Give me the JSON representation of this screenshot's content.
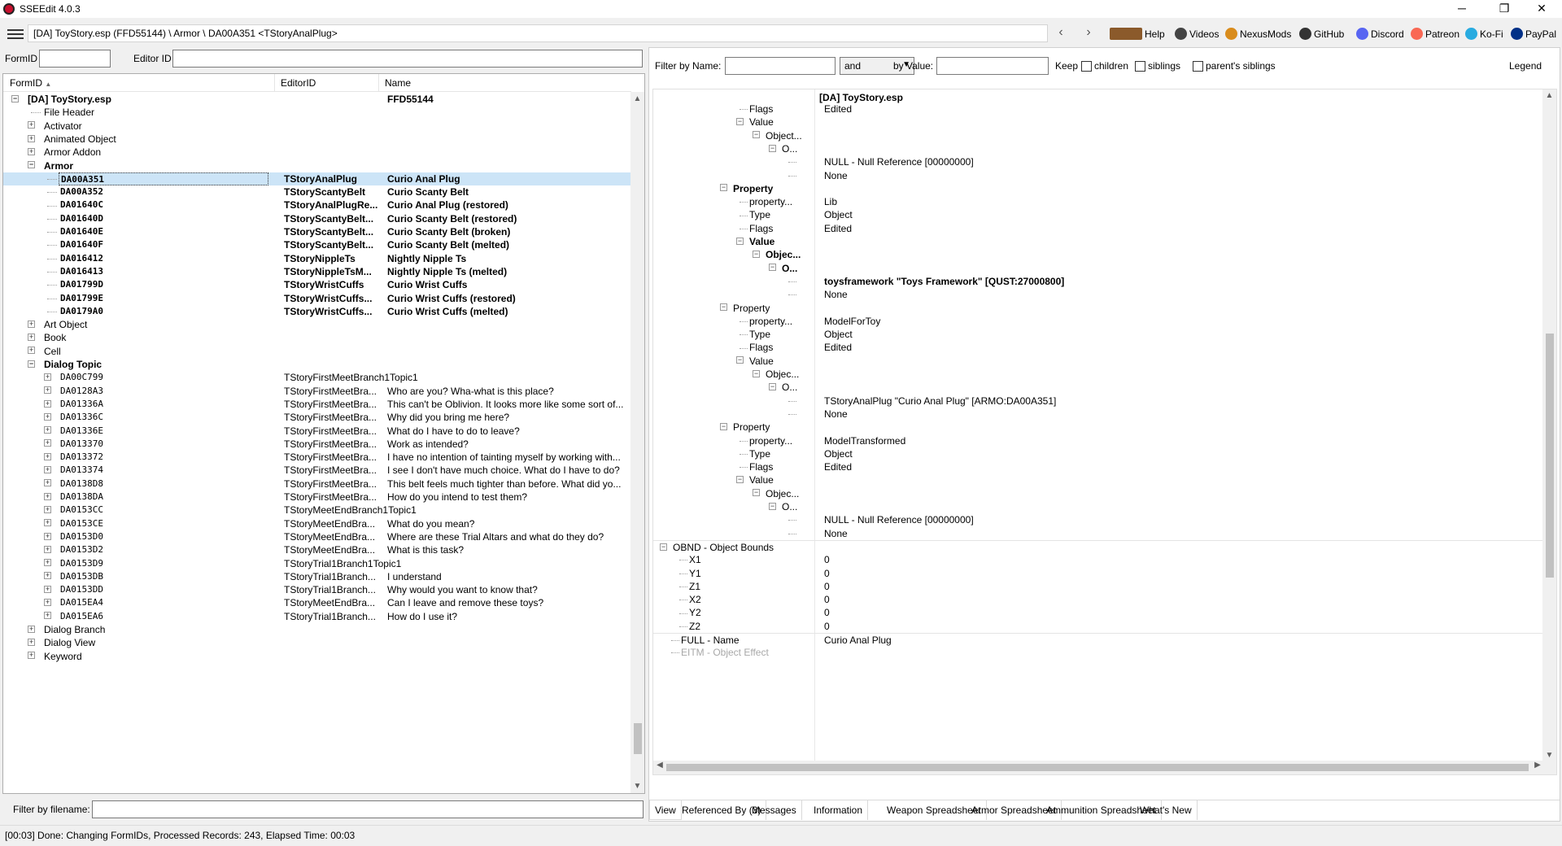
{
  "window": {
    "title": "SSEEdit 4.0.3",
    "minimize": "─",
    "maximize": "❐",
    "close": "✕"
  },
  "toolbar": {
    "path": "[DA] ToyStory.esp (FFD55144) \\ Armor \\ DA00A351 <TStoryAnalPlug>",
    "back": "‹",
    "forward": "›",
    "links": [
      {
        "label": "Help",
        "color": "#8b5a2b"
      },
      {
        "label": "Videos",
        "color": "#444444"
      },
      {
        "label": "NexusMods",
        "color": "#d98c1c"
      },
      {
        "label": "GitHub",
        "color": "#333333"
      },
      {
        "label": "Discord",
        "color": "#5865f2"
      },
      {
        "label": "Patreon",
        "color": "#f96854"
      },
      {
        "label": "Ko-Fi",
        "color": "#29abe0"
      },
      {
        "label": "PayPal",
        "color": "#003087"
      }
    ]
  },
  "left": {
    "formid_label": "FormID",
    "formid_value": "",
    "editorid_label": "Editor ID",
    "editorid_value": "",
    "columns": [
      "FormID",
      "EditorID",
      "Name"
    ],
    "sort_arrow": "▲",
    "filename_label": "Filter by filename:",
    "filename_value": "",
    "rows": [
      {
        "level": 0,
        "exp": "⊟",
        "formid": "[DA] ToyStory.esp",
        "editor": "",
        "name": "FFD55144",
        "bold": true,
        "mono": false
      },
      {
        "level": 1,
        "exp": "",
        "formid": "File Header",
        "editor": "",
        "name": "",
        "bold": false,
        "mono": false
      },
      {
        "level": 1,
        "exp": "⊞",
        "formid": "Activator",
        "editor": "",
        "name": "",
        "bold": false,
        "mono": false
      },
      {
        "level": 1,
        "exp": "⊞",
        "formid": "Animated Object",
        "editor": "",
        "name": "",
        "bold": false,
        "mono": false
      },
      {
        "level": 1,
        "exp": "⊞",
        "formid": "Armor Addon",
        "editor": "",
        "name": "",
        "bold": false,
        "mono": false
      },
      {
        "level": 1,
        "exp": "⊟",
        "formid": "Armor",
        "editor": "",
        "name": "",
        "bold": true,
        "mono": false
      },
      {
        "level": 2,
        "exp": "",
        "formid": "DA00A351",
        "editor": "TStoryAnalPlug",
        "name": "Curio Anal Plug",
        "bold": true,
        "mono": true,
        "sel": true
      },
      {
        "level": 2,
        "exp": "",
        "formid": "DA00A352",
        "editor": "TStoryScantyBelt",
        "name": "Curio Scanty Belt",
        "bold": true,
        "mono": true
      },
      {
        "level": 2,
        "exp": "",
        "formid": "DA01640C",
        "editor": "TStoryAnalPlugRe...",
        "name": "Curio Anal Plug (restored)",
        "bold": true,
        "mono": true
      },
      {
        "level": 2,
        "exp": "",
        "formid": "DA01640D",
        "editor": "TStoryScantyBelt...",
        "name": "Curio Scanty Belt (restored)",
        "bold": true,
        "mono": true
      },
      {
        "level": 2,
        "exp": "",
        "formid": "DA01640E",
        "editor": "TStoryScantyBelt...",
        "name": "Curio Scanty Belt (broken)",
        "bold": true,
        "mono": true
      },
      {
        "level": 2,
        "exp": "",
        "formid": "DA01640F",
        "editor": "TStoryScantyBelt...",
        "name": "Curio Scanty Belt (melted)",
        "bold": true,
        "mono": true
      },
      {
        "level": 2,
        "exp": "",
        "formid": "DA016412",
        "editor": "TStoryNippleTs",
        "name": "Nightly Nipple Ts",
        "bold": true,
        "mono": true
      },
      {
        "level": 2,
        "exp": "",
        "formid": "DA016413",
        "editor": "TStoryNippleTsM...",
        "name": "Nightly Nipple Ts (melted)",
        "bold": true,
        "mono": true
      },
      {
        "level": 2,
        "exp": "",
        "formid": "DA01799D",
        "editor": "TStoryWristCuffs",
        "name": "Curio Wrist Cuffs",
        "bold": true,
        "mono": true
      },
      {
        "level": 2,
        "exp": "",
        "formid": "DA01799E",
        "editor": "TStoryWristCuffs...",
        "name": "Curio Wrist Cuffs (restored)",
        "bold": true,
        "mono": true
      },
      {
        "level": 2,
        "exp": "",
        "formid": "DA0179A0",
        "editor": "TStoryWristCuffs...",
        "name": "Curio Wrist Cuffs (melted)",
        "bold": true,
        "mono": true
      },
      {
        "level": 1,
        "exp": "⊞",
        "formid": "Art Object",
        "editor": "",
        "name": "",
        "bold": false,
        "mono": false
      },
      {
        "level": 1,
        "exp": "⊞",
        "formid": "Book",
        "editor": "",
        "name": "",
        "bold": false,
        "mono": false
      },
      {
        "level": 1,
        "exp": "⊞",
        "formid": "Cell",
        "editor": "",
        "name": "",
        "bold": false,
        "mono": false
      },
      {
        "level": 1,
        "exp": "⊟",
        "formid": "Dialog Topic",
        "editor": "",
        "name": "",
        "bold": true,
        "mono": false
      },
      {
        "level": 2,
        "exp": "⊞",
        "formid": "DA00C799",
        "editor": "TStoryFirstMeetBranch1Topic1",
        "name": "",
        "bold": false,
        "mono": true,
        "wide": true
      },
      {
        "level": 2,
        "exp": "⊞",
        "formid": "DA0128A3",
        "editor": "TStoryFirstMeetBra...",
        "name": "Who are you? Wha-what is this place?",
        "bold": false,
        "mono": true
      },
      {
        "level": 2,
        "exp": "⊞",
        "formid": "DA01336A",
        "editor": "TStoryFirstMeetBra...",
        "name": "This can't be Oblivion.  It looks more like some sort of...",
        "bold": false,
        "mono": true
      },
      {
        "level": 2,
        "exp": "⊞",
        "formid": "DA01336C",
        "editor": "TStoryFirstMeetBra...",
        "name": "Why did you bring me here?",
        "bold": false,
        "mono": true
      },
      {
        "level": 2,
        "exp": "⊞",
        "formid": "DA01336E",
        "editor": "TStoryFirstMeetBra...",
        "name": "What do I have to do to leave?",
        "bold": false,
        "mono": true
      },
      {
        "level": 2,
        "exp": "⊞",
        "formid": "DA013370",
        "editor": "TStoryFirstMeetBra...",
        "name": "Work as intended?",
        "bold": false,
        "mono": true
      },
      {
        "level": 2,
        "exp": "⊞",
        "formid": "DA013372",
        "editor": "TStoryFirstMeetBra...",
        "name": "I have no intention of tainting myself by working with...",
        "bold": false,
        "mono": true
      },
      {
        "level": 2,
        "exp": "⊞",
        "formid": "DA013374",
        "editor": "TStoryFirstMeetBra...",
        "name": "I see I don't have much choice.  What do I have to do?",
        "bold": false,
        "mono": true
      },
      {
        "level": 2,
        "exp": "⊞",
        "formid": "DA0138D8",
        "editor": "TStoryFirstMeetBra...",
        "name": "This belt feels much tighter than before.  What did yo...",
        "bold": false,
        "mono": true
      },
      {
        "level": 2,
        "exp": "⊞",
        "formid": "DA0138DA",
        "editor": "TStoryFirstMeetBra...",
        "name": "How do you intend to test them?",
        "bold": false,
        "mono": true
      },
      {
        "level": 2,
        "exp": "⊞",
        "formid": "DA0153CC",
        "editor": "TStoryMeetEndBranch1Topic1",
        "name": "",
        "bold": false,
        "mono": true,
        "wide": true
      },
      {
        "level": 2,
        "exp": "⊞",
        "formid": "DA0153CE",
        "editor": "TStoryMeetEndBra...",
        "name": "What do you mean?",
        "bold": false,
        "mono": true
      },
      {
        "level": 2,
        "exp": "⊞",
        "formid": "DA0153D0",
        "editor": "TStoryMeetEndBra...",
        "name": "Where are these Trial Altars and what do they do?",
        "bold": false,
        "mono": true
      },
      {
        "level": 2,
        "exp": "⊞",
        "formid": "DA0153D2",
        "editor": "TStoryMeetEndBra...",
        "name": "What is this task?",
        "bold": false,
        "mono": true
      },
      {
        "level": 2,
        "exp": "⊞",
        "formid": "DA0153D9",
        "editor": "TStoryTrial1Branch1Topic1",
        "name": "",
        "bold": false,
        "mono": true,
        "wide": true
      },
      {
        "level": 2,
        "exp": "⊞",
        "formid": "DA0153DB",
        "editor": "TStoryTrial1Branch...",
        "name": "I understand",
        "bold": false,
        "mono": true
      },
      {
        "level": 2,
        "exp": "⊞",
        "formid": "DA0153DD",
        "editor": "TStoryTrial1Branch...",
        "name": "Why would you want to know that?",
        "bold": false,
        "mono": true
      },
      {
        "level": 2,
        "exp": "⊞",
        "formid": "DA015EA4",
        "editor": "TStoryMeetEndBra...",
        "name": "Can I leave and remove these toys?",
        "bold": false,
        "mono": true
      },
      {
        "level": 2,
        "exp": "⊞",
        "formid": "DA015EA6",
        "editor": "TStoryTrial1Branch...",
        "name": "How do I use it?",
        "bold": false,
        "mono": true
      },
      {
        "level": 1,
        "exp": "⊞",
        "formid": "Dialog Branch",
        "editor": "",
        "name": "",
        "bold": false,
        "mono": false
      },
      {
        "level": 1,
        "exp": "⊞",
        "formid": "Dialog View",
        "editor": "",
        "name": "",
        "bold": false,
        "mono": false
      },
      {
        "level": 1,
        "exp": "⊞",
        "formid": "Keyword",
        "editor": "",
        "name": "",
        "bold": false,
        "mono": false
      }
    ]
  },
  "right": {
    "filter_name_label": "Filter by Name:",
    "filter_name_value": "",
    "combo_value": "and",
    "by_value_label": "by Value:",
    "by_value_value": "",
    "keep_label": "Keep",
    "children_label": "children",
    "siblings_label": "siblings",
    "parents_label": "parent's siblings",
    "legend_label": "Legend",
    "header_value": "[DA] ToyStory.esp",
    "rows": [
      {
        "indent": 104,
        "exp": "",
        "label": "Flags",
        "value": "Edited",
        "bold": false
      },
      {
        "indent": 104,
        "exp": "⊟",
        "label": "Value",
        "value": "",
        "bold": false
      },
      {
        "indent": 124,
        "exp": "⊟",
        "label": "Object...",
        "value": "",
        "bold": false
      },
      {
        "indent": 144,
        "exp": "⊟",
        "label": "O...",
        "value": "",
        "bold": false
      },
      {
        "indent": 164,
        "exp": "",
        "label": "",
        "value": "NULL - Null Reference [00000000]",
        "bold": false
      },
      {
        "indent": 164,
        "exp": "",
        "label": "",
        "value": "None",
        "bold": false
      },
      {
        "indent": 84,
        "exp": "⊟",
        "label": "Property",
        "value": "",
        "bold": true
      },
      {
        "indent": 104,
        "exp": "",
        "label": "property...",
        "value": "Lib",
        "bold": false
      },
      {
        "indent": 104,
        "exp": "",
        "label": "Type",
        "value": "Object",
        "bold": false
      },
      {
        "indent": 104,
        "exp": "",
        "label": "Flags",
        "value": "Edited",
        "bold": false
      },
      {
        "indent": 104,
        "exp": "⊟",
        "label": "Value",
        "value": "",
        "bold": true
      },
      {
        "indent": 124,
        "exp": "⊟",
        "label": "Objec...",
        "value": "",
        "bold": true
      },
      {
        "indent": 144,
        "exp": "⊟",
        "label": "O...",
        "value": "",
        "bold": true
      },
      {
        "indent": 164,
        "exp": "",
        "label": "",
        "value": "toysframework \"Toys Framework\" [QUST:27000800]",
        "bold": true
      },
      {
        "indent": 164,
        "exp": "",
        "label": "",
        "value": "None",
        "bold": false
      },
      {
        "indent": 84,
        "exp": "⊟",
        "label": "Property",
        "value": "",
        "bold": false
      },
      {
        "indent": 104,
        "exp": "",
        "label": "property...",
        "value": "ModelForToy",
        "bold": false
      },
      {
        "indent": 104,
        "exp": "",
        "label": "Type",
        "value": "Object",
        "bold": false
      },
      {
        "indent": 104,
        "exp": "",
        "label": "Flags",
        "value": "Edited",
        "bold": false
      },
      {
        "indent": 104,
        "exp": "⊟",
        "label": "Value",
        "value": "",
        "bold": false
      },
      {
        "indent": 124,
        "exp": "⊟",
        "label": "Objec...",
        "value": "",
        "bold": false
      },
      {
        "indent": 144,
        "exp": "⊟",
        "label": "O...",
        "value": "",
        "bold": false
      },
      {
        "indent": 164,
        "exp": "",
        "label": "",
        "value": "TStoryAnalPlug \"Curio Anal Plug\" [ARMO:DA00A351]",
        "bold": false
      },
      {
        "indent": 164,
        "exp": "",
        "label": "",
        "value": "None",
        "bold": false
      },
      {
        "indent": 84,
        "exp": "⊟",
        "label": "Property",
        "value": "",
        "bold": false
      },
      {
        "indent": 104,
        "exp": "",
        "label": "property...",
        "value": "ModelTransformed",
        "bold": false
      },
      {
        "indent": 104,
        "exp": "",
        "label": "Type",
        "value": "Object",
        "bold": false
      },
      {
        "indent": 104,
        "exp": "",
        "label": "Flags",
        "value": "Edited",
        "bold": false
      },
      {
        "indent": 104,
        "exp": "⊟",
        "label": "Value",
        "value": "",
        "bold": false
      },
      {
        "indent": 124,
        "exp": "⊟",
        "label": "Objec...",
        "value": "",
        "bold": false
      },
      {
        "indent": 144,
        "exp": "⊟",
        "label": "O...",
        "value": "",
        "bold": false
      },
      {
        "indent": 164,
        "exp": "",
        "label": "",
        "value": "NULL - Null Reference [00000000]",
        "bold": false
      },
      {
        "indent": 164,
        "exp": "",
        "label": "",
        "value": "None",
        "bold": false
      },
      {
        "indent": 10,
        "exp": "⊟",
        "label": "OBND - Object Bounds",
        "value": "",
        "bold": false,
        "sep": true
      },
      {
        "indent": 30,
        "exp": "",
        "label": "X1",
        "value": "0",
        "bold": false
      },
      {
        "indent": 30,
        "exp": "",
        "label": "Y1",
        "value": "0",
        "bold": false
      },
      {
        "indent": 30,
        "exp": "",
        "label": "Z1",
        "value": "0",
        "bold": false
      },
      {
        "indent": 30,
        "exp": "",
        "label": "X2",
        "value": "0",
        "bold": false
      },
      {
        "indent": 30,
        "exp": "",
        "label": "Y2",
        "value": "0",
        "bold": false
      },
      {
        "indent": 30,
        "exp": "",
        "label": "Z2",
        "value": "0",
        "bold": false
      },
      {
        "indent": 20,
        "exp": "",
        "label": "FULL - Name",
        "value": "Curio Anal Plug",
        "bold": false,
        "sep": true
      },
      {
        "indent": 20,
        "exp": "",
        "label": "EITM - Object Effect",
        "value": "",
        "bold": false,
        "faded": true
      }
    ],
    "tabs": [
      "View",
      "Referenced By (3)",
      "Messages",
      "Information",
      "Weapon Spreadsheet",
      "Armor Spreadsheet",
      "Ammunition Spreadsheet",
      "What's New"
    ]
  },
  "status": "[00:03] Done: Changing FormIDs, Processed Records: 243, Elapsed Time: 00:03"
}
